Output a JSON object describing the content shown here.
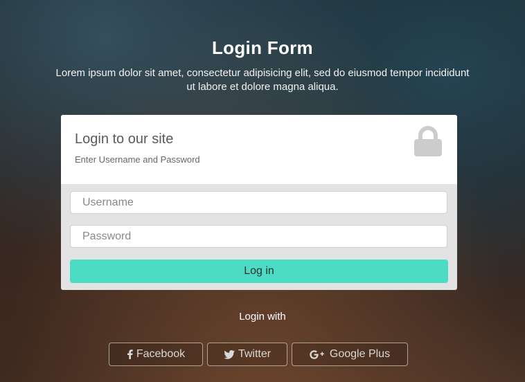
{
  "header": {
    "title": "Login Form",
    "description": "Lorem ipsum dolor sit amet, consectetur adipisicing elit, sed do eiusmod tempor incididunt ut labore et dolore magna aliqua."
  },
  "card": {
    "heading": "Login to our site",
    "subheading": "Enter Username and Password",
    "icon": "lock-icon",
    "username": {
      "value": "",
      "placeholder": "Username"
    },
    "password": {
      "value": "",
      "placeholder": "Password"
    },
    "login_label": "Log in"
  },
  "social": {
    "label": "Login with",
    "buttons": [
      {
        "label": "Facebook",
        "icon": "facebook-icon"
      },
      {
        "label": "Twitter",
        "icon": "twitter-icon"
      },
      {
        "label": "Google Plus",
        "icon": "google-plus-icon"
      }
    ]
  },
  "colors": {
    "accent": "#4cdcc3",
    "card_bg": "#ffffff",
    "card_body_bg": "#e3e3e3"
  }
}
